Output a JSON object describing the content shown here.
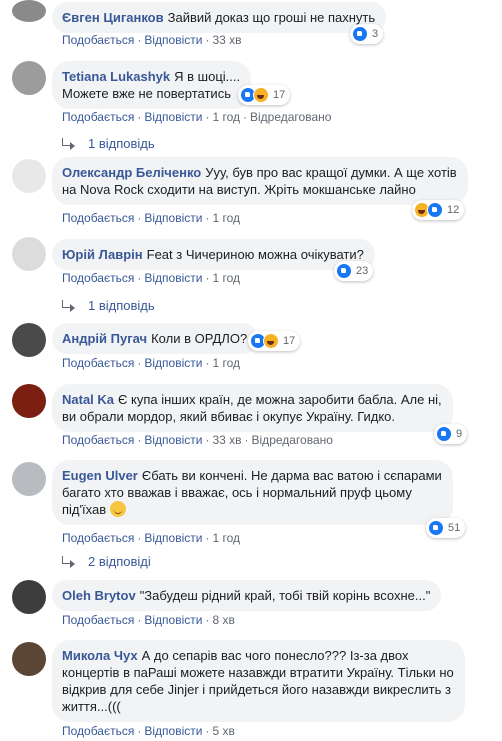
{
  "actions": {
    "like": "Подобається",
    "reply": "Відповісти",
    "edited": "Відредаговано",
    "sep": "·"
  },
  "colors": {
    "author": "#385898",
    "bubble": "#f2f3f5",
    "like": "#1877f2",
    "haha": "#f7b125"
  },
  "comments": [
    {
      "author": "Євген Циганков",
      "text": "Зайвий доказ що гроші не пахнуть",
      "time": "33 хв",
      "reactions": [
        "like"
      ],
      "count": "3"
    },
    {
      "author": "Tetiana Lukashyk",
      "text_lines": [
        "Я в шоці....",
        "Можете вже не повертатись"
      ],
      "time": "1 год",
      "edited": true,
      "reactions": [
        "like",
        "haha"
      ],
      "count": "17",
      "replies": "1 відповідь"
    },
    {
      "author": "Олександр Беліченко",
      "text_lines": [
        "Ууу, був про вас кращої думки. А ще хотів",
        "на Nova Rock сходити на виступ. Жріть мокшанське лайно"
      ],
      "time": "1 год",
      "reactions": [
        "haha",
        "like"
      ],
      "count": "12"
    },
    {
      "author": "Юрій Лаврін",
      "text": "Feat з Чичериною можна очікувати?",
      "time": "1 год",
      "reactions": [
        "like"
      ],
      "count": "23",
      "replies": "1 відповідь"
    },
    {
      "author": "Андрій Пугач",
      "text": "Коли в ОРДЛО?",
      "time": "1 год",
      "reactions": [
        "like",
        "haha"
      ],
      "count": "17"
    },
    {
      "author": "Natal Ka",
      "text_lines": [
        "Є купа інших країн, де можна заробити бабла. Але ні,",
        "ви обрали мордор, який вбиває і окупує Україну. Гидко."
      ],
      "time": "33 хв",
      "edited": true,
      "reactions": [
        "like"
      ],
      "count": "9"
    },
    {
      "author": "Eugen Ulver",
      "text_lines": [
        "Єбать ви кончені. Не дарма вас ватою і сєпарами",
        "багато хто вважав і вважає, ось і нормальний пруф цьому",
        "під'їхав"
      ],
      "time": "1 год",
      "reactions": [
        "like"
      ],
      "count": "51",
      "replies": "2 відповіді"
    },
    {
      "author": "Oleh Brytov",
      "text": "\"Забудеш рідний край, тобі твій корінь всохне...\"",
      "time": "8 хв"
    },
    {
      "author": "Микола Чух",
      "text_lines": [
        "А до сепарів вас чого понесло??? Із-за двох",
        "концертів в паРаші можете назавжди втратити Україну. Тільки но",
        "відкрив для себе Jinjer і прийдеться його назавжди викреслить з",
        "життя...((("
      ],
      "time": "5 хв"
    }
  ]
}
